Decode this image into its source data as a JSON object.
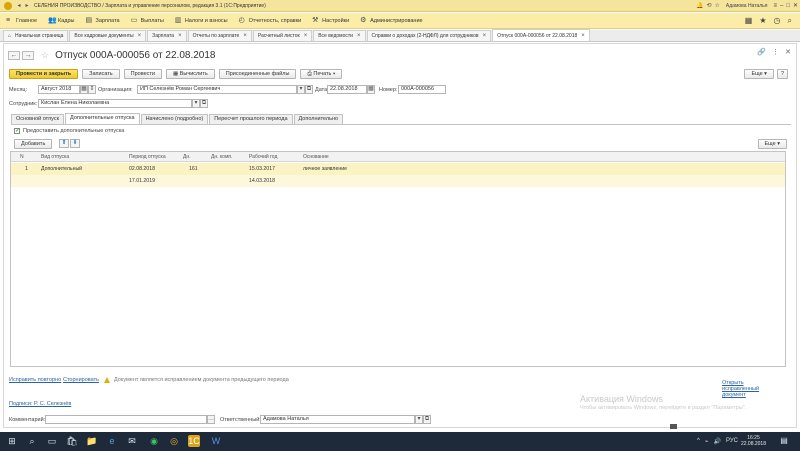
{
  "titlebar": {
    "title": "СЕЛЕНИЯ ПРОИЗВОДСТВО / Зарплата и управление персоналом, редакция 3.1 (1С:Предприятие)",
    "user": "Адамова Наталья"
  },
  "menu": [
    {
      "icon": "menu-icon",
      "label": "Главное"
    },
    {
      "icon": "people-icon",
      "label": "Кадры"
    },
    {
      "icon": "money-icon",
      "label": "Зарплата"
    },
    {
      "icon": "payout-icon",
      "label": "Выплаты"
    },
    {
      "icon": "tax-icon",
      "label": "Налоги и взносы"
    },
    {
      "icon": "report-icon",
      "label": "Отчетность, справки"
    },
    {
      "icon": "settings-icon",
      "label": "Настройки"
    },
    {
      "icon": "gear-icon",
      "label": "Администрирование"
    }
  ],
  "window_tabs": [
    {
      "label": "Начальная страница",
      "closable": false
    },
    {
      "label": "Все кадровые документы",
      "closable": true
    },
    {
      "label": "Зарплата",
      "closable": true
    },
    {
      "label": "Отчеты по зарплате",
      "closable": true
    },
    {
      "label": "Расчетный листок",
      "closable": true
    },
    {
      "label": "Все ведомости",
      "closable": true
    },
    {
      "label": "Справки о доходах (2-НДФЛ) для сотрудников",
      "closable": true
    },
    {
      "label": "Отпуск 000А-000056 от 22.08.2018",
      "closable": true,
      "active": true
    }
  ],
  "form": {
    "title": "Отпуск 000А-000056 от 22.08.2018",
    "buttons": {
      "post_close": "Провести и закрыть",
      "save": "Записать",
      "post": "Провести",
      "calculate": "Вычислить",
      "attachments": "Присоединенные файлы",
      "print": "Печать",
      "more": "Еще"
    },
    "fields": {
      "month_label": "Месяц:",
      "month_value": "Август 2018",
      "org_label": "Организация:",
      "org_value": "ИП Селезнёв Роман Сергеевич",
      "date_label": "Дата:",
      "date_value": "22.08.2018",
      "number_label": "Номер:",
      "number_value": "000А-000056",
      "employee_label": "Сотрудник:",
      "employee_value": "Кислан Елена Николаевна"
    },
    "tabs": [
      "Основной отпуск",
      "Дополнительные отпуска",
      "Начислено (подробно)",
      "Пересчет прошлого периода",
      "Дополнительно"
    ],
    "active_tab_index": 1,
    "checkbox_label": "Предоставить дополнительные отпуска",
    "checkbox_checked": true,
    "add_button": "Добавить",
    "grid_more": "Еще",
    "grid": {
      "columns": [
        "N",
        "Вид отпуска",
        "Период отпуска",
        "Дн.",
        "Дн. комп.",
        "Рабочий год",
        "Основание"
      ],
      "rows": [
        {
          "n": "1",
          "type": "Дополнительный",
          "period_from": "02.08.2018",
          "period_to": "17.01.2019",
          "days": "161",
          "comp_days": "",
          "year_from": "15.03.2017",
          "year_to": "14.03.2018",
          "basis": "личное заявление"
        }
      ]
    },
    "footer": {
      "fix_link": "Исправить повторно",
      "cancel_link": "Сторнировать",
      "note": "Документ является исправлением документа предыдущего периода",
      "open_fix_link": "Открыть исправленный документ",
      "signature_link": "Подписи: Р. С. Селезнёв",
      "comment_label": "Комментарий:",
      "comment_value": "",
      "responsible_label": "Ответственный:",
      "responsible_value": "Адамова Наталья"
    }
  },
  "watermark": {
    "line1": "Активация Windows",
    "line2": "Чтобы активировать Windows, перейдите в раздел \"Параметры\"."
  },
  "taskbar": {
    "time": "16:25",
    "date": "22.08.2018",
    "lang": "РУС"
  }
}
